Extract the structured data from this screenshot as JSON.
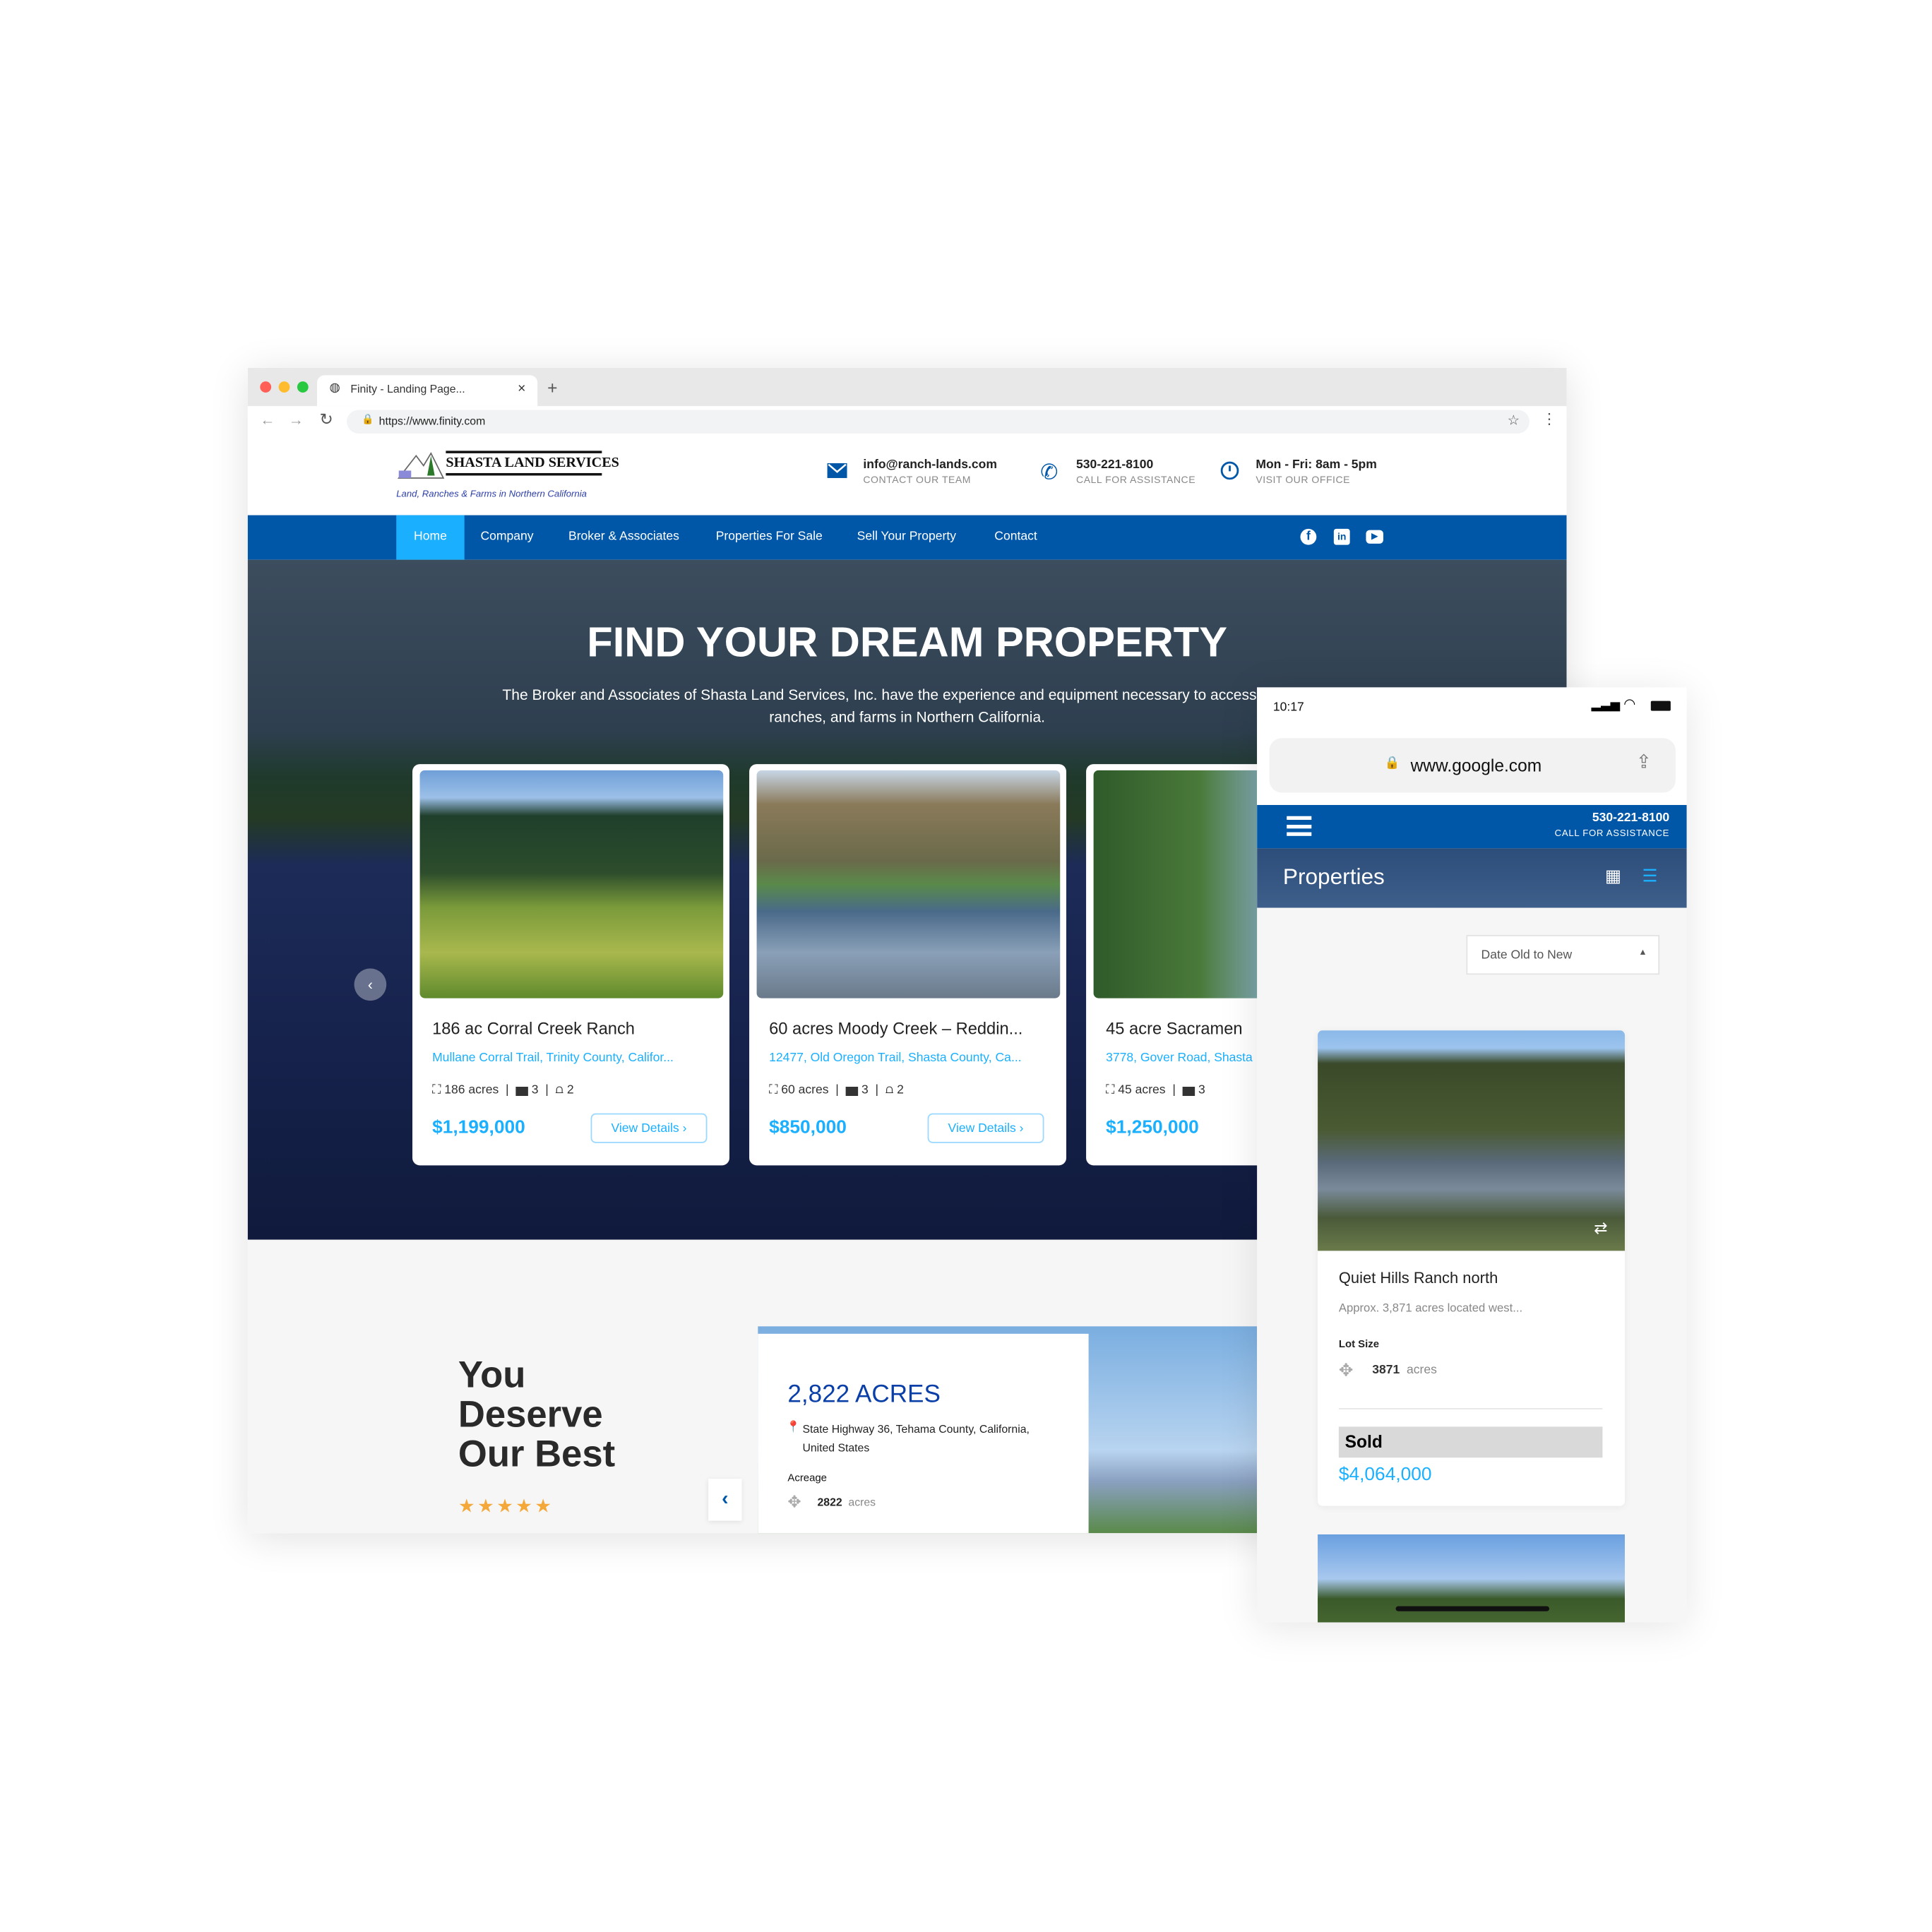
{
  "browser": {
    "tab_title": "Finity - Landing Page...",
    "url": "https://www.finity.com",
    "new_tab": "+",
    "close": "×"
  },
  "site": {
    "logo": {
      "name": "SHASTA LAND SERVICES",
      "tagline": "Land, Ranches & Farms in Northern California"
    },
    "contacts": [
      {
        "icon": "envelope-icon",
        "value": "info@ranch-lands.com",
        "label": "CONTACT OUR TEAM"
      },
      {
        "icon": "phone-icon",
        "value": "530-221-8100",
        "label": "CALL FOR ASSISTANCE"
      },
      {
        "icon": "clock-icon",
        "value": "Mon - Fri: 8am - 5pm",
        "label": "VISIT OUR OFFICE"
      }
    ],
    "nav": [
      "Home",
      "Company",
      "Broker & Associates",
      "Properties For Sale",
      "Sell Your Property",
      "Contact"
    ],
    "active_nav": "Home",
    "social": [
      "facebook-icon",
      "linkedin-icon",
      "youtube-icon"
    ],
    "hero": {
      "title": "FIND YOUR DREAM PROPERTY",
      "subtitle": "The Broker and Associates of Shasta Land Services, Inc. have the experience and equipment necessary to access all land, ranches, and farms in Northern California."
    },
    "cards": [
      {
        "title": "186 ac Corral Creek Ranch",
        "address": "Mullane Corral Trail, Trinity County, Califor...",
        "acres": "186 acres",
        "beds": "3",
        "baths": "2",
        "price": "$1,199,000",
        "button": "View Details"
      },
      {
        "title": "60 acres Moody Creek – Reddin...",
        "address": "12477, Old Oregon Trail, Shasta County, Ca...",
        "acres": "60 acres",
        "beds": "3",
        "baths": "2",
        "price": "$850,000",
        "button": "View Details"
      },
      {
        "title": "45 acre Sacramen",
        "address": "3778, Gover Road, Shasta",
        "acres": "45 acres",
        "beds": "3",
        "baths": "",
        "price": "$1,250,000",
        "button": ""
      }
    ],
    "lower": {
      "heading": [
        "You",
        "Deserve",
        "Our Best"
      ],
      "rating": 5,
      "feature": {
        "title": "2,822 ACRES",
        "address": "State Highway 36, Tehama County, California, United States",
        "acreage_label": "Acreage",
        "acreage_value": "2822",
        "acreage_unit": "acres"
      }
    }
  },
  "phone": {
    "time": "10:17",
    "url": "www.google.com",
    "phone_number": "530-221-8100",
    "phone_label": "CALL FOR ASSISTANCE",
    "page_title": "Properties",
    "sort": "Date Old to New",
    "card": {
      "title": "Quiet Hills Ranch north",
      "desc": "Approx. 3,871 acres located west...",
      "lot_label": "Lot Size",
      "lot_value": "3871",
      "lot_unit": "acres",
      "status": "Sold",
      "price": "$4,064,000"
    }
  },
  "colors": {
    "brand_blue": "#0057a8",
    "accent": "#1ab0ff",
    "star": "#f5a83a"
  }
}
